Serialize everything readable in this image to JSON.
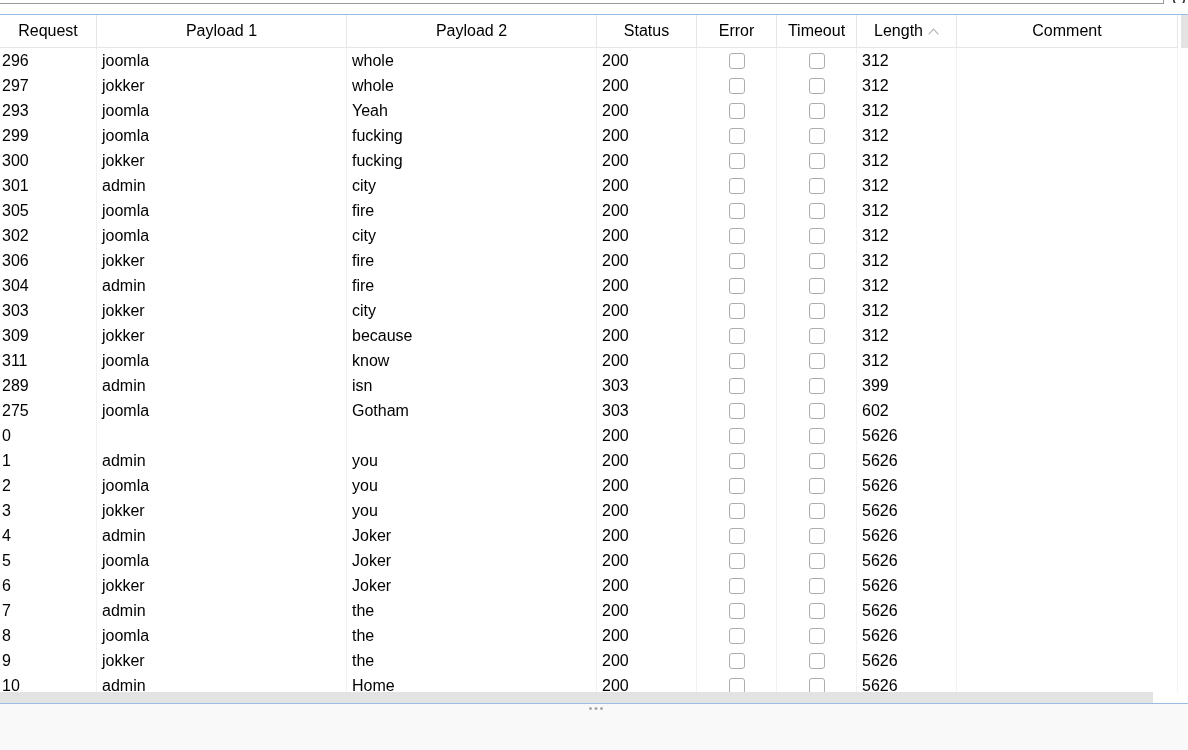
{
  "table": {
    "columns": [
      {
        "label": "Request",
        "kind": "text",
        "sorted": false
      },
      {
        "label": "Payload 1",
        "kind": "text",
        "sorted": false
      },
      {
        "label": "Payload 2",
        "kind": "text",
        "sorted": false
      },
      {
        "label": "Status",
        "kind": "text",
        "sorted": false
      },
      {
        "label": "Error",
        "kind": "checkbox",
        "sorted": false
      },
      {
        "label": "Timeout",
        "kind": "checkbox",
        "sorted": false
      },
      {
        "label": "Length",
        "kind": "text",
        "sorted": true
      },
      {
        "label": "Comment",
        "kind": "text",
        "sorted": false
      }
    ],
    "rows": [
      {
        "request": "296",
        "payload_1": "joomla",
        "payload_2": "whole",
        "status": "200",
        "error": false,
        "timeout": false,
        "length": "312"
      },
      {
        "request": "297",
        "payload_1": "jokker",
        "payload_2": "whole",
        "status": "200",
        "error": false,
        "timeout": false,
        "length": "312"
      },
      {
        "request": "293",
        "payload_1": "joomla",
        "payload_2": "Yeah",
        "status": "200",
        "error": false,
        "timeout": false,
        "length": "312"
      },
      {
        "request": "299",
        "payload_1": "joomla",
        "payload_2": "fucking",
        "status": "200",
        "error": false,
        "timeout": false,
        "length": "312"
      },
      {
        "request": "300",
        "payload_1": "jokker",
        "payload_2": "fucking",
        "status": "200",
        "error": false,
        "timeout": false,
        "length": "312"
      },
      {
        "request": "301",
        "payload_1": "admin",
        "payload_2": "city",
        "status": "200",
        "error": false,
        "timeout": false,
        "length": "312"
      },
      {
        "request": "305",
        "payload_1": "joomla",
        "payload_2": "fire",
        "status": "200",
        "error": false,
        "timeout": false,
        "length": "312"
      },
      {
        "request": "302",
        "payload_1": "joomla",
        "payload_2": "city",
        "status": "200",
        "error": false,
        "timeout": false,
        "length": "312"
      },
      {
        "request": "306",
        "payload_1": "jokker",
        "payload_2": "fire",
        "status": "200",
        "error": false,
        "timeout": false,
        "length": "312"
      },
      {
        "request": "304",
        "payload_1": "admin",
        "payload_2": "fire",
        "status": "200",
        "error": false,
        "timeout": false,
        "length": "312"
      },
      {
        "request": "303",
        "payload_1": "jokker",
        "payload_2": "city",
        "status": "200",
        "error": false,
        "timeout": false,
        "length": "312"
      },
      {
        "request": "309",
        "payload_1": "jokker",
        "payload_2": "because",
        "status": "200",
        "error": false,
        "timeout": false,
        "length": "312"
      },
      {
        "request": "311",
        "payload_1": "joomla",
        "payload_2": "know",
        "status": "200",
        "error": false,
        "timeout": false,
        "length": "312"
      },
      {
        "request": "289",
        "payload_1": "admin",
        "payload_2": "isn",
        "status": "303",
        "error": false,
        "timeout": false,
        "length": "399"
      },
      {
        "request": "275",
        "payload_1": "joomla",
        "payload_2": "Gotham",
        "status": "303",
        "error": false,
        "timeout": false,
        "length": "602"
      },
      {
        "request": "0",
        "status": "200",
        "error": false,
        "timeout": false,
        "length": "5626"
      },
      {
        "request": "1",
        "payload_1": "admin",
        "payload_2": "you",
        "status": "200",
        "error": false,
        "timeout": false,
        "length": "5626"
      },
      {
        "request": "2",
        "payload_1": "joomla",
        "payload_2": "you",
        "status": "200",
        "error": false,
        "timeout": false,
        "length": "5626"
      },
      {
        "request": "3",
        "payload_1": "jokker",
        "payload_2": "you",
        "status": "200",
        "error": false,
        "timeout": false,
        "length": "5626"
      },
      {
        "request": "4",
        "payload_1": "admin",
        "payload_2": "Joker",
        "status": "200",
        "error": false,
        "timeout": false,
        "length": "5626"
      },
      {
        "request": "5",
        "payload_1": "joomla",
        "payload_2": "Joker",
        "status": "200",
        "error": false,
        "timeout": false,
        "length": "5626"
      },
      {
        "request": "6",
        "payload_1": "jokker",
        "payload_2": "Joker",
        "status": "200",
        "error": false,
        "timeout": false,
        "length": "5626"
      },
      {
        "request": "7",
        "payload_1": "admin",
        "payload_2": "the",
        "status": "200",
        "error": false,
        "timeout": false,
        "length": "5626"
      },
      {
        "request": "8",
        "payload_1": "joomla",
        "payload_2": "the",
        "status": "200",
        "error": false,
        "timeout": false,
        "length": "5626"
      },
      {
        "request": "9",
        "payload_1": "jokker",
        "payload_2": "the",
        "status": "200",
        "error": false,
        "timeout": false,
        "length": "5626"
      },
      {
        "request": "10",
        "payload_1": "admin",
        "payload_2": "Home",
        "status": "200",
        "error": false,
        "timeout": false,
        "length": "5626"
      }
    ]
  }
}
